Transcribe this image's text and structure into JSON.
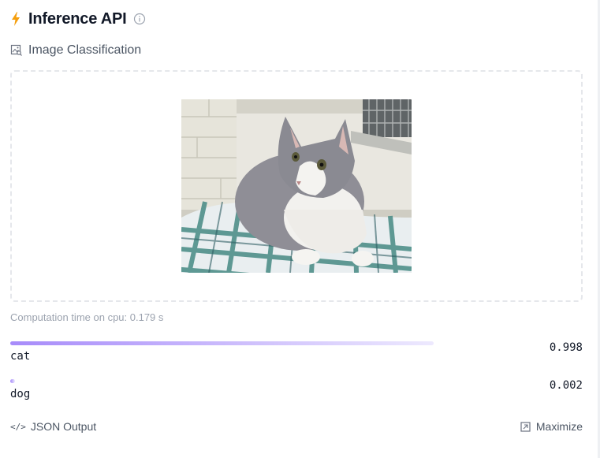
{
  "header": {
    "title": "Inference API"
  },
  "task": {
    "label": "Image Classification"
  },
  "computation": {
    "text": "Computation time on cpu: 0.179 s"
  },
  "results": [
    {
      "label": "cat",
      "score": "0.998",
      "fraction": 0.998
    },
    {
      "label": "dog",
      "score": "0.002",
      "fraction": 0.002
    }
  ],
  "footer": {
    "json_output_label": "JSON Output",
    "maximize_label": "Maximize"
  },
  "colors": {
    "accent": "#f59e0b",
    "bar_start": "#a78bfa",
    "bar_end": "#ede9fe"
  }
}
